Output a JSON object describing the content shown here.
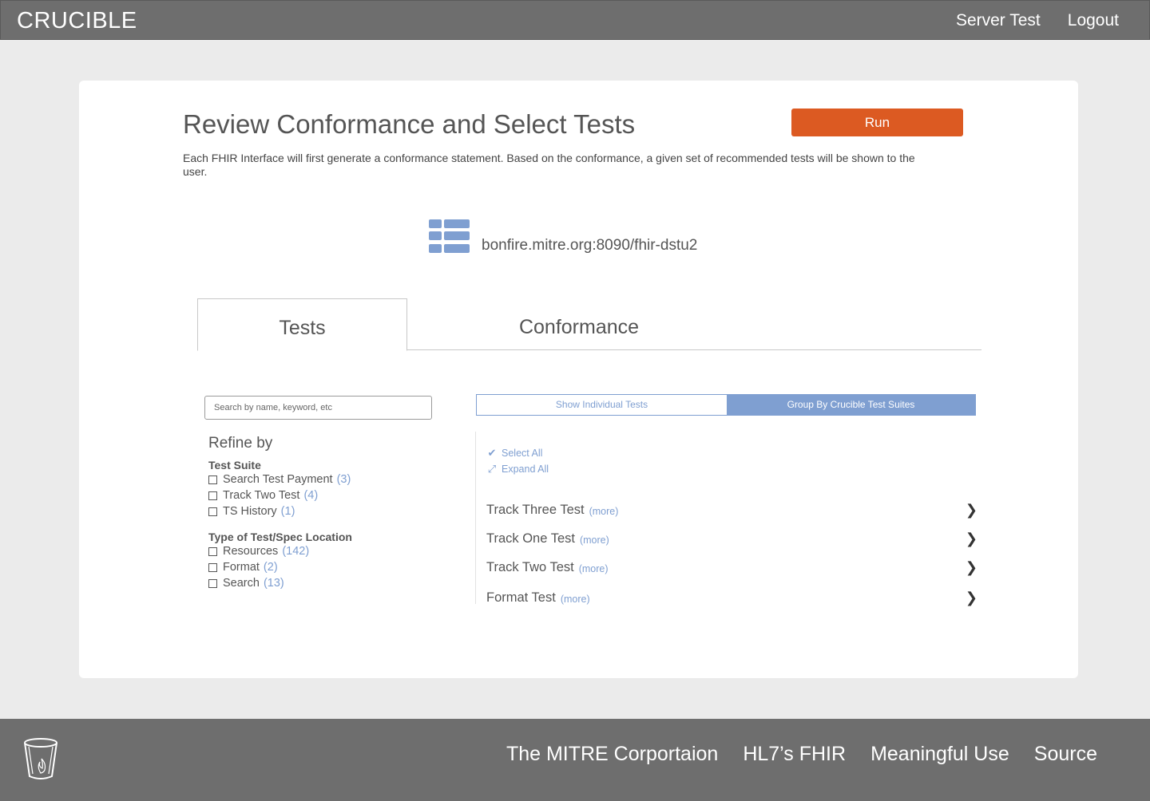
{
  "header": {
    "brand": "CRUCIBLE",
    "nav": [
      "Server Test",
      "Logout"
    ]
  },
  "main": {
    "title": "Review Conformance and Select Tests",
    "run_label": "Run",
    "intro": "Each FHIR Interface will first generate a conformance statement. Based on the conformance, a given set of recommended tests will be shown to the user.",
    "server_url": "bonfire.mitre.org:8090/fhir-dstu2",
    "tabs": [
      "Tests",
      "Conformance"
    ]
  },
  "filters": {
    "search_placeholder": "Search by name, keyword, etc",
    "refine_title": "Refine by",
    "groups": [
      {
        "title": "Test Suite",
        "items": [
          {
            "label": "Search Test Payment",
            "count": "(3)"
          },
          {
            "label": "Track Two Test",
            "count": "(4)"
          },
          {
            "label": "TS History",
            "count": "(1)"
          }
        ]
      },
      {
        "title": "Type of Test/Spec Location",
        "items": [
          {
            "label": "Resources",
            "count": "(142)"
          },
          {
            "label": "Format",
            "count": "(2)"
          },
          {
            "label": "Search",
            "count": "(13)"
          }
        ]
      }
    ]
  },
  "results": {
    "toggle": [
      "Show Individual Tests",
      "Group By Crucible Test Suites"
    ],
    "select_all": "Select All",
    "expand_all": "Expand All",
    "more_label": "(more)",
    "suites": [
      "Track Three Test",
      "Track One Test",
      "Track Two Test",
      "Format Test"
    ]
  },
  "footer": {
    "links": [
      "The MITRE Corportaion",
      "HL7’s FHIR",
      "Meaningful Use",
      "Source"
    ]
  },
  "colors": {
    "header_bg": "#6e6e6e",
    "accent_blue": "#7f9fd1",
    "run_orange": "#dc5a22"
  }
}
